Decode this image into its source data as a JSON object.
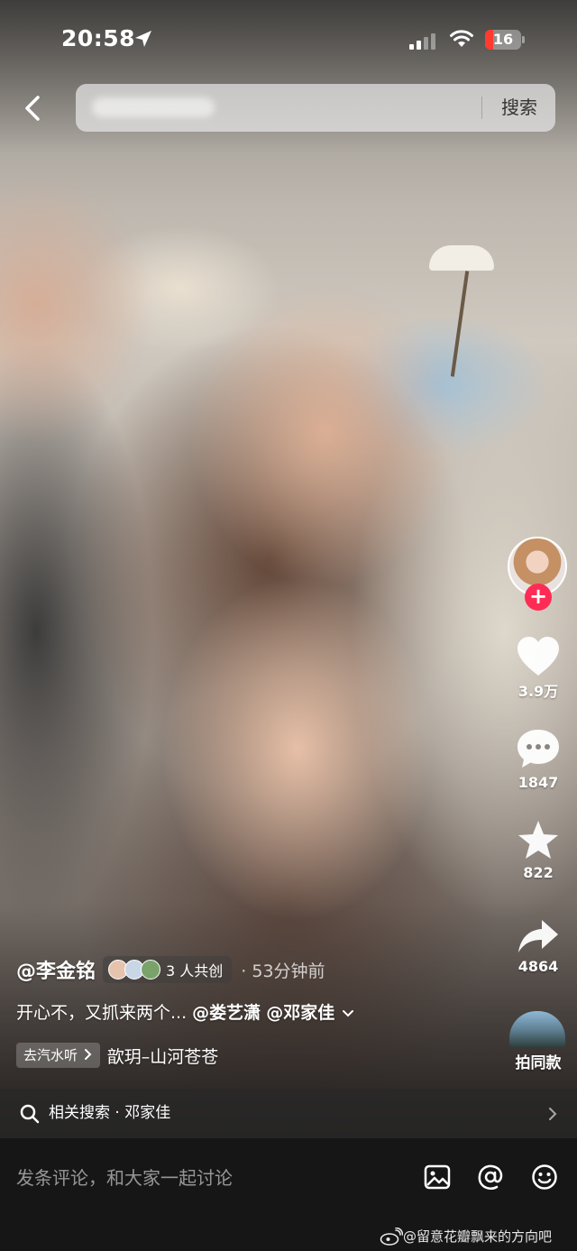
{
  "status_bar": {
    "time": "20:58",
    "battery": "16",
    "battery_color": "#ff3b30"
  },
  "top_nav": {
    "back_icon": "chevron-left-icon",
    "search_button_label": "搜索"
  },
  "right_rail": {
    "like_count": "3.9万",
    "comment_count": "1847",
    "favorite_count": "822",
    "share_count": "4864",
    "same_style_label": "拍同款",
    "follow_color": "#fe2c55"
  },
  "caption": {
    "author": "@李金铭",
    "co_create_label": "3 人共创",
    "time_ago": "· 53分钟前",
    "text": "开心不，又抓来两个...",
    "mention_1": "@娄艺潇",
    "mention_2": "@邓家佳"
  },
  "music": {
    "tag": "去汽水听",
    "title": "歆玥–山河苍苍"
  },
  "related_search": {
    "label": "相关搜索",
    "separator": "·",
    "term": "邓家佳"
  },
  "comment_bar": {
    "placeholder": "发条评论，和大家一起讨论",
    "icons": [
      "image-icon",
      "at-icon",
      "emoji-icon"
    ]
  },
  "watermark": {
    "text": "@留意花瓣飘来的方向吧"
  }
}
